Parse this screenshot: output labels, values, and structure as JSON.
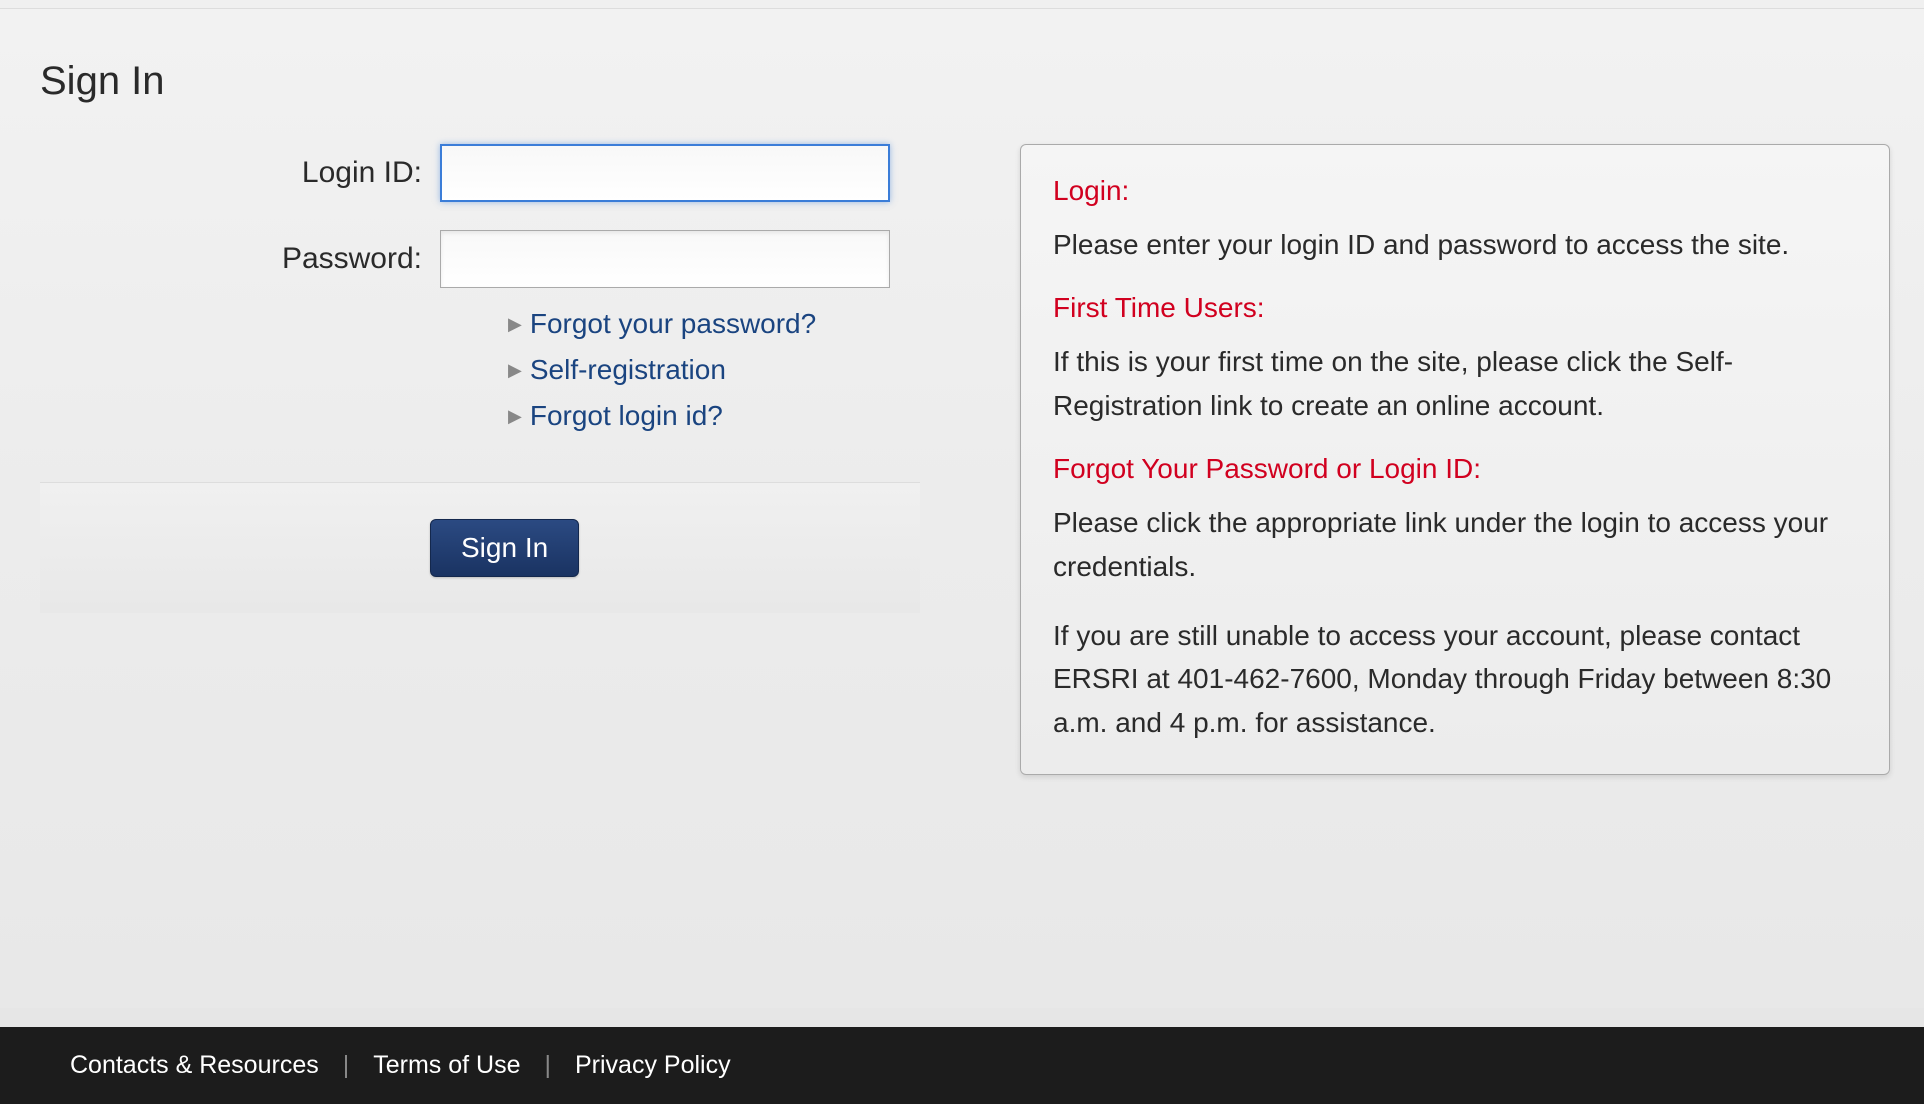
{
  "page": {
    "title": "Sign In"
  },
  "form": {
    "loginLabel": "Login ID:",
    "passwordLabel": "Password:",
    "loginValue": "",
    "passwordValue": ""
  },
  "links": {
    "forgotPassword": "Forgot your password?",
    "selfRegistration": "Self-registration",
    "forgotLoginId": "Forgot login id?"
  },
  "button": {
    "signIn": "Sign In"
  },
  "info": {
    "loginHeading": "Login:",
    "loginText": "Please enter your login ID and password to access the site.",
    "firstTimeHeading": "First Time Users:",
    "firstTimeText": "If this is your first time on the site, please click the Self-Registration link to create an online account.",
    "forgotHeading": "Forgot Your Password or Login ID:",
    "forgotText": "Please click the appropriate link under the login to access your credentials.",
    "contactText": "If you are still unable to access your account, please contact ERSRI at 401-462-7600, Monday through Friday between 8:30 a.m. and 4 p.m. for assistance."
  },
  "footer": {
    "contacts": "Contacts & Resources",
    "terms": "Terms of Use",
    "privacy": "Privacy Policy"
  }
}
